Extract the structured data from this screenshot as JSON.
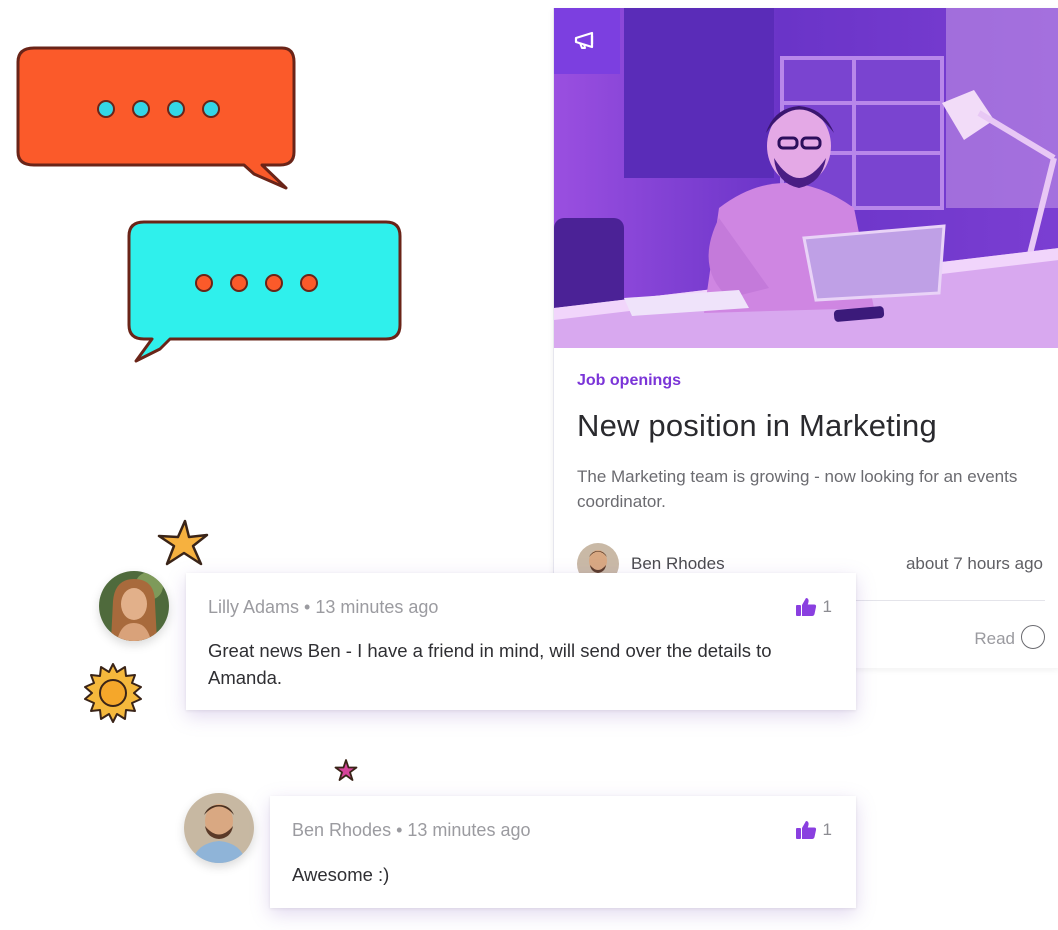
{
  "post": {
    "category": "Job openings",
    "title": "New position in Marketing",
    "summary": "The Marketing team is growing - now looking for an events coordinator.",
    "author": "Ben Rhodes",
    "time": "about 7 hours ago",
    "read_label": "Read"
  },
  "comments": [
    {
      "author": "Lilly Adams",
      "time": "13 minutes ago",
      "text": "Great news Ben - I have a friend in mind, will send over the details to Amanda.",
      "likes": "1"
    },
    {
      "author": "Ben Rhodes",
      "time": "13 minutes ago",
      "text": "Awesome :)",
      "likes": "1"
    }
  ],
  "separator": " • ",
  "colors": {
    "accent": "#7c3fe0",
    "bubble_orange": "#fb5a2a",
    "bubble_cyan": "#2ff0ec",
    "star_gold": "#f6b13f",
    "star_pink": "#d6449a"
  },
  "icons": {
    "megaphone": "megaphone-icon",
    "like": "thumbs-up-icon",
    "read": "circle-check-icon"
  }
}
